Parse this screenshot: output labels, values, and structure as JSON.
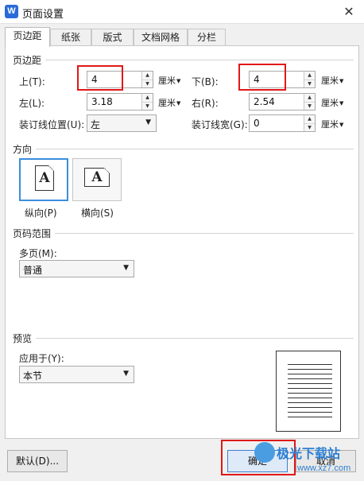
{
  "window": {
    "app_icon_glyph": "W",
    "title": "页面设置",
    "close_glyph": "✕"
  },
  "tabs": [
    {
      "label": "页边距",
      "active": true
    },
    {
      "label": "纸张",
      "active": false
    },
    {
      "label": "版式",
      "active": false
    },
    {
      "label": "文档网格",
      "active": false
    },
    {
      "label": "分栏",
      "active": false
    }
  ],
  "margins": {
    "section_title": "页边距",
    "top": {
      "label": "上(T):",
      "value": "4",
      "unit": "厘米"
    },
    "bottom": {
      "label": "下(B):",
      "value": "4",
      "unit": "厘米"
    },
    "left": {
      "label": "左(L):",
      "value": "3.18",
      "unit": "厘米"
    },
    "right": {
      "label": "右(R):",
      "value": "2.54",
      "unit": "厘米"
    },
    "gutter_position": {
      "label": "装订线位置(U):",
      "value": "左"
    },
    "gutter_width": {
      "label": "装订线宽(G):",
      "value": "0",
      "unit": "厘米"
    }
  },
  "orientation": {
    "section_title": "方向",
    "portrait": {
      "label": "纵向(P)",
      "glyph": "A",
      "selected": true
    },
    "landscape": {
      "label": "横向(S)",
      "glyph": "A",
      "selected": false
    }
  },
  "pages": {
    "section_title": "页码范围",
    "multiple_label": "多页(M):",
    "multiple_value": "普通"
  },
  "preview": {
    "section_title": "预览",
    "apply_label": "应用于(Y):",
    "apply_value": "本节"
  },
  "buttons": {
    "default": "默认(D)...",
    "ok": "确定",
    "cancel": "取消"
  },
  "watermark": {
    "cn": "极光下载站",
    "url": "www.xz7.com"
  },
  "colors": {
    "highlight": "#e01818",
    "selected_border": "#3b8ede",
    "app_icon": "#2a6bd8"
  }
}
